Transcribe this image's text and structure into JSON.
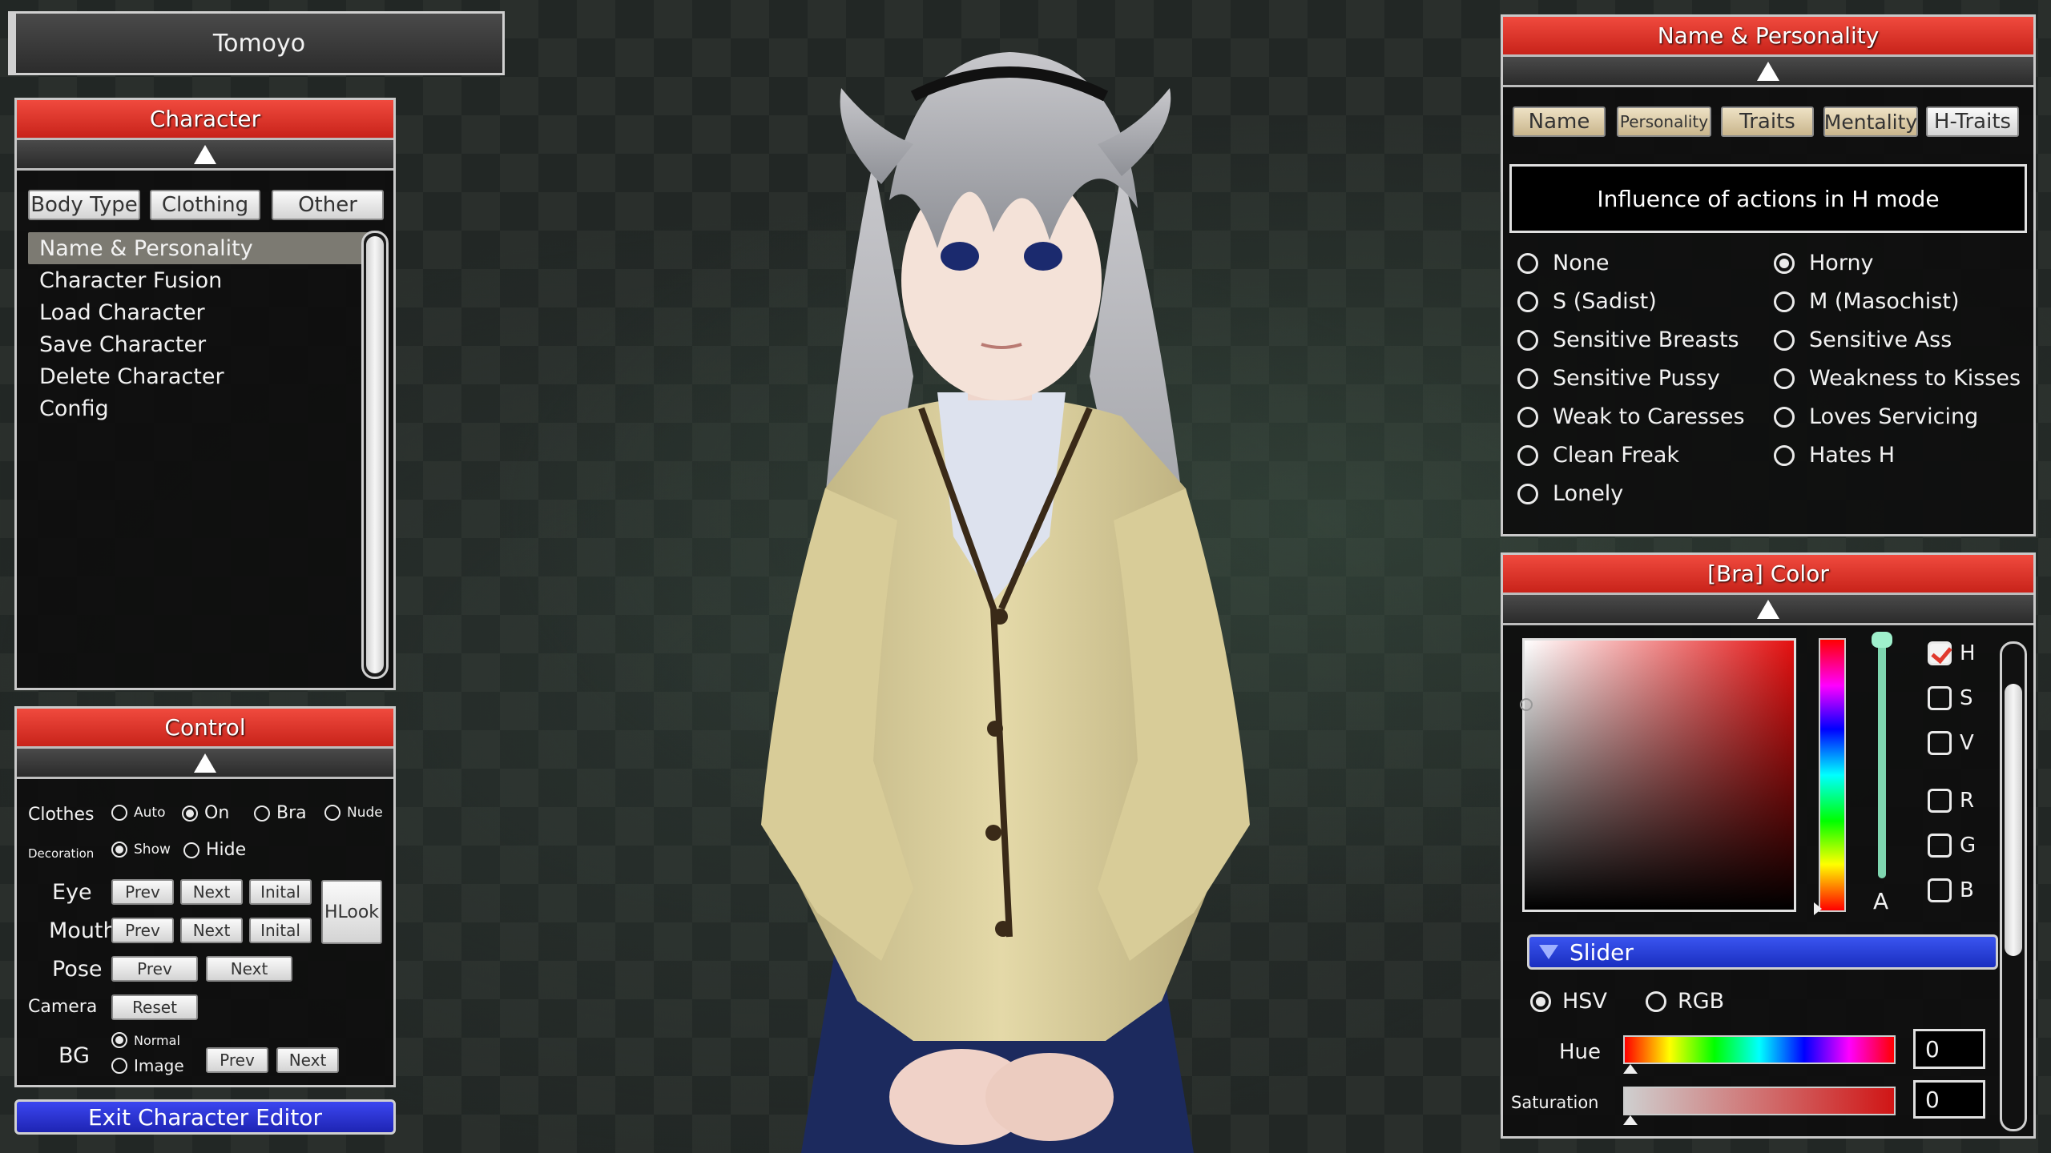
{
  "character_name": "Tomoyo",
  "character_panel": {
    "title": "Character",
    "tabs": [
      "Body Type",
      "Clothing",
      "Other"
    ],
    "menu": [
      "Name & Personality",
      "Character Fusion",
      "Load Character",
      "Save Character",
      "Delete Character",
      "Config"
    ],
    "selected": "Name & Personality"
  },
  "control_panel": {
    "title": "Control",
    "clothes": {
      "label": "Clothes",
      "options": [
        "Auto",
        "On",
        "Bra",
        "Nude"
      ],
      "selected": "On"
    },
    "decoration": {
      "label": "Decoration",
      "options": [
        "Show",
        "Hide"
      ],
      "selected": "Show"
    },
    "eye": {
      "label": "Eye",
      "prev": "Prev",
      "next": "Next",
      "initial": "Inital"
    },
    "mouth": {
      "label": "Mouth",
      "prev": "Prev",
      "next": "Next",
      "initial": "Inital"
    },
    "hlook": "HLook",
    "pose": {
      "label": "Pose",
      "prev": "Prev",
      "next": "Next"
    },
    "camera": {
      "label": "Camera",
      "reset": "Reset"
    },
    "bg": {
      "label": "BG",
      "options": [
        "Normal",
        "Image"
      ],
      "selected": "Normal",
      "prev": "Prev",
      "next": "Next"
    }
  },
  "exit_button": "Exit Character Editor",
  "name_personality_panel": {
    "title": "Name & Personality",
    "tabs": [
      "Name",
      "Personality",
      "Traits",
      "Mentality",
      "H-Traits"
    ],
    "active_tab": "H-Traits",
    "heading": "Influence of actions in H mode",
    "traits_left": [
      "None",
      "S (Sadist)",
      "Sensitive Breasts",
      "Sensitive Pussy",
      "Weak to Caresses",
      "Clean Freak",
      "Lonely"
    ],
    "traits_right": [
      "Horny",
      "M (Masochist)",
      "Sensitive Ass",
      "Weakness to Kisses",
      "Loves Servicing",
      "Hates H"
    ],
    "selected": "Horny"
  },
  "color_panel": {
    "title": "[Bra] Color",
    "alpha_label": "A",
    "channels": [
      {
        "label": "H",
        "checked": true
      },
      {
        "label": "S",
        "checked": false
      },
      {
        "label": "V",
        "checked": false
      },
      {
        "label": "R",
        "checked": false
      },
      {
        "label": "G",
        "checked": false
      },
      {
        "label": "B",
        "checked": false
      }
    ],
    "slider_header": "Slider",
    "mode_options": [
      "HSV",
      "RGB"
    ],
    "mode_selected": "HSV",
    "hue_label": "Hue",
    "hue_value": "0",
    "saturation_label": "Saturation",
    "saturation_value": "0",
    "selected_color": "#e41010"
  }
}
